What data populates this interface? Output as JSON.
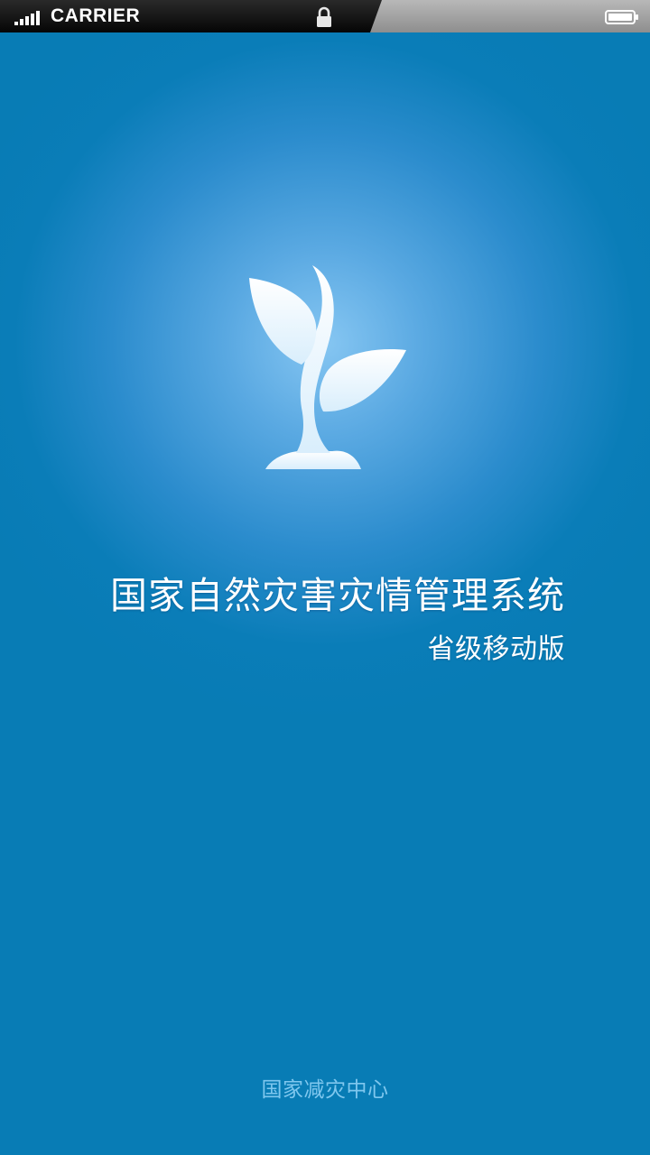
{
  "status_bar": {
    "carrier": "CARRIER",
    "signal_icon": "signal-bars-icon",
    "lock_icon": "lock-icon",
    "battery_icon": "battery-icon"
  },
  "splash": {
    "logo_icon": "sprout-icon",
    "title": "国家自然灾害灾情管理系统",
    "subtitle": "省级移动版",
    "footer": "国家减灾中心"
  },
  "colors": {
    "background": "#087cb5",
    "glow": "#86c6f2",
    "text": "#ffffff",
    "footer_text": "#7fc7ee"
  }
}
